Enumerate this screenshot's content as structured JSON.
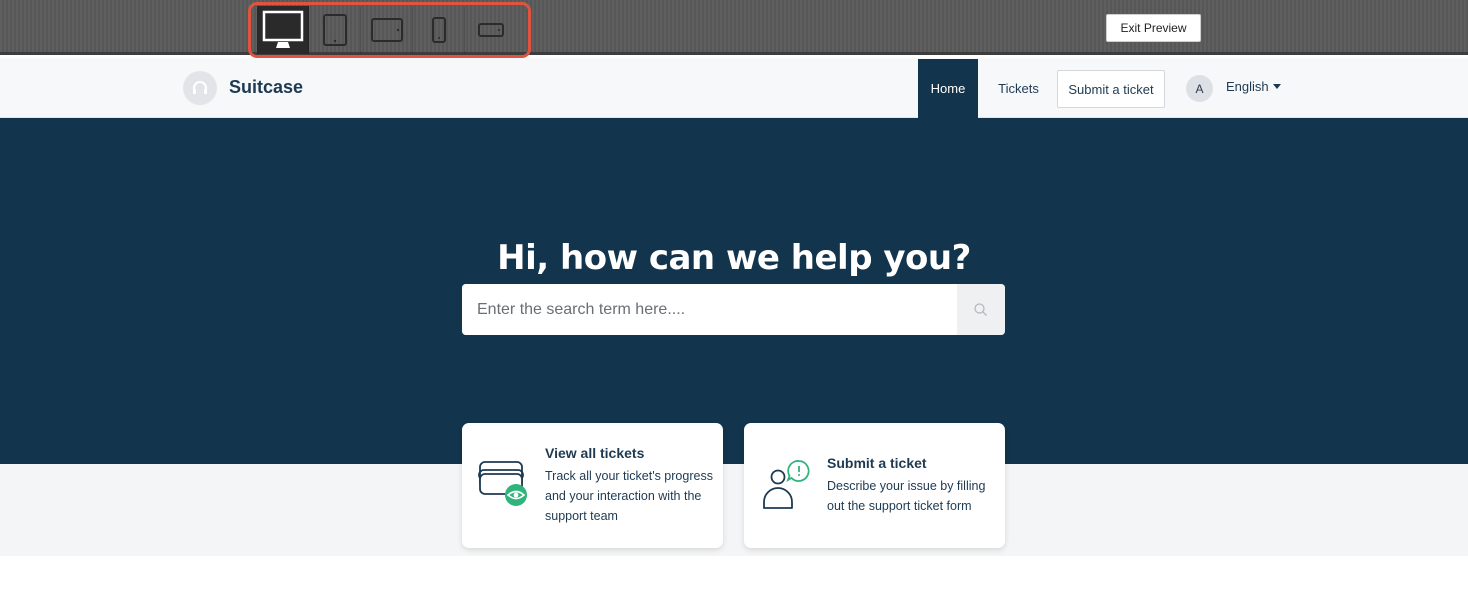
{
  "preview": {
    "devices": [
      {
        "name": "desktop",
        "active": true
      },
      {
        "name": "tablet-portrait",
        "active": false
      },
      {
        "name": "tablet-landscape",
        "active": false
      },
      {
        "name": "mobile-portrait",
        "active": false
      },
      {
        "name": "mobile-landscape",
        "active": false
      }
    ],
    "exit_label": "Exit Preview"
  },
  "header": {
    "brand": "Suitcase",
    "nav": {
      "home": "Home",
      "tickets": "Tickets",
      "submit": "Submit a ticket"
    },
    "avatar_initial": "A",
    "language": "English"
  },
  "hero": {
    "title": "Hi, how can we help you?",
    "search_placeholder": "Enter the search term here...."
  },
  "cards": [
    {
      "title": "View all tickets",
      "description": "Track all your ticket's progress and your interaction with the support team"
    },
    {
      "title": "Submit a ticket",
      "description": "Describe your issue by filling out the support ticket form"
    }
  ],
  "colors": {
    "primary": "#13344d",
    "accent": "#2fb47c",
    "highlight": "#e0533f"
  }
}
